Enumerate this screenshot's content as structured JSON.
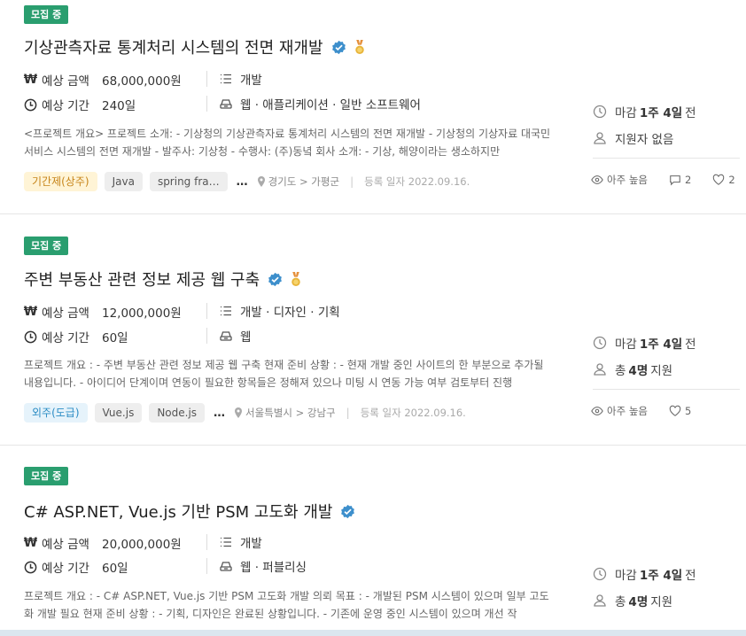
{
  "colors": {
    "badge": "#2a9e6f",
    "verified": "#3d8fcc",
    "medal": "#e8b43a",
    "tag_type_a": "#c7851a",
    "tag_type_b": "#2b8cc4"
  },
  "labels": {
    "amount": "예상 금액",
    "duration": "예상 기간",
    "more": "…",
    "registered_prefix": "등록 일자",
    "views": "아주 높음"
  },
  "cards": [
    {
      "status": "모집 중",
      "title": "기상관측자료 통계처리 시스템의 전면 재개발",
      "verified": true,
      "medal": true,
      "amount": "68,000,000원",
      "duration": "240일",
      "category": "개발",
      "platform": "웹 · 애플리케이션 · 일반 소프트웨어",
      "description": "<프로젝트 개요> 프로젝트 소개: - 기상청의 기상관측자료 통계처리 시스템의 전면 재개발 - 기상청의 기상자료 대국민 서비스 시스템의 전면 재개발 - 발주사: 기상청 - 수행사: (주)동녘 회사 소개: - 기상, 해양이라는 생소하지만",
      "type_tag": "기간제(상주)",
      "tags": [
        "Java",
        "spring fra…"
      ],
      "location": "경기도 > 가평군",
      "date": "2022.09.16.",
      "deadline_prefix": "마감",
      "deadline_value": "1주 4일",
      "deadline_suffix": "전",
      "applicants_prefix": "지원자 없음",
      "applicants_value": "",
      "applicants_suffix": "",
      "views": "아주 높음",
      "comments": "2",
      "likes": "2"
    },
    {
      "status": "모집 중",
      "title": "주변 부동산 관련 정보 제공 웹 구축",
      "verified": true,
      "medal": true,
      "amount": "12,000,000원",
      "duration": "60일",
      "category": "개발 · 디자인 · 기획",
      "platform": "웹",
      "description": "프로젝트 개요 : - 주변 부동산 관련 정보 제공 웹 구축 현재 준비 상황 : - 현재 개발 중인 사이트의 한 부분으로 추가될 내용입니다. - 아이디어 단계이며 연동이 필요한 항목들은 정해져 있으나 미팅 시 연동 가능 여부 검토부터 진행",
      "type_tag": "외주(도급)",
      "tags": [
        "Vue.js",
        "Node.js"
      ],
      "location": "서울특별시 > 강남구",
      "date": "2022.09.16.",
      "deadline_prefix": "마감",
      "deadline_value": "1주 4일",
      "deadline_suffix": "전",
      "applicants_prefix": "총",
      "applicants_value": "4명",
      "applicants_suffix": "지원",
      "views": "아주 높음",
      "comments": "",
      "likes": "5"
    },
    {
      "status": "모집 중",
      "title": "C# ASP.NET, Vue.js 기반 PSM 고도화 개발",
      "verified": true,
      "medal": false,
      "amount": "20,000,000원",
      "duration": "60일",
      "category": "개발",
      "platform": "웹 · 퍼블리싱",
      "description": "프로젝트 개요 : - C# ASP.NET, Vue.js 기반 PSM 고도화 개발 의뢰 목표 : - 개발된 PSM 시스템이 있으며 일부 고도화 개발 필요 현재 준비 상황 : - 기획, 디자인은 완료된 상황입니다. - 기존에 운영 중인 시스템이 있으며 개선 작",
      "deadline_prefix": "마감",
      "deadline_value": "1주 4일",
      "deadline_suffix": "전",
      "applicants_prefix": "총",
      "applicants_value": "4명",
      "applicants_suffix": "지원"
    }
  ]
}
